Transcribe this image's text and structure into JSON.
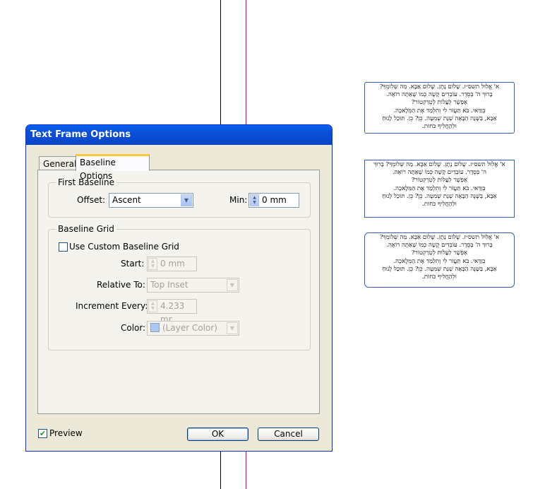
{
  "dialog": {
    "title": "Text Frame Options",
    "tabs": [
      {
        "label": "General"
      },
      {
        "label": "Baseline Options"
      }
    ],
    "first_baseline": {
      "legend": "First Baseline",
      "offset_label": "Offset:",
      "offset_value": "Ascent",
      "min_label": "Min:",
      "min_value": "0 mm"
    },
    "baseline_grid": {
      "legend": "Baseline Grid",
      "use_custom_label": "Use Custom Baseline Grid",
      "use_custom_checked": false,
      "start_label": "Start:",
      "start_value": "0 mm",
      "relative_to_label": "Relative To:",
      "relative_to_value": "Top Inset",
      "increment_label": "Increment Every:",
      "increment_value": "4.233 mr",
      "color_label": "Color:",
      "color_value": "(Layer Color)",
      "color_swatch": "#a9c9f3"
    },
    "preview_label": "Preview",
    "preview_checked": true,
    "ok_label": "OK",
    "cancel_label": "Cancel"
  },
  "colors": {
    "title_bar": "#0a52df",
    "frame_border": "#2f5fc6",
    "guide_magenta": "#b000b0"
  },
  "icons": {
    "dropdown": "chevron-down-icon",
    "spinner": "spin-arrows-icon",
    "check": "check-icon"
  },
  "frames": [
    {
      "lines": [
        "א' אֱלוּל תשס״ז. שָׁלוֹם נָתָן. שָׁלוֹם אַבָּא. מַה שְּׁלוֹמְךָ?",
        "בָּרוּךְ ה' בְּסֵדֶר. עוֹבְדִים קָשֶׁה כְּמוֹ שֶׁאַתָּה רוֹאֶה.",
        "אֶפְשָׁר לַעֲלוֹת לְטְרַקְטוֹר?",
        "בְּוַדַּאי. בֹּא תַּעֲזֹר לִי וְתִלְמַד אֶת הַמְּלָאכָה.",
        "אַבָּא, בַּשָּׁנָה הַבָּאָה שְׁנַת שְׁמִטָּה. כֵּן? כֵּן. תּוּכַל לָנוּחַ",
        "וּלְהַחֲלִיף כֹּחוֹת."
      ]
    },
    {
      "lines": [
        "א' אֱלוּל תשס״ז. שָׁלוֹם נָתָן. שָׁלוֹם אַבָּא. מַה שְּׁלוֹמְךָ? בָּרוּךְ",
        "ה' בְּסֵדֶר. עוֹבְדִים קָשֶׁה כְּמוֹ שֶׁאַתָּה רוֹאֶה.",
        "אֶפְשָׁר לַעֲלוֹת לְטְרַקְטוֹר?",
        "בְּוַדַּאי. בֹּא תַּעֲזֹר לִי וְתִלְמַד אֶת הַמְּלָאכָה.",
        "אַבָּא, בַּשָּׁנָה הַבָּאָה שְׁנַת שְׁמִטָּה. כֵּן? כֵּן. תּוּכַל לָנוּחַ",
        "וּלְהַחֲלִיף כֹּחוֹת."
      ]
    },
    {
      "lines": [
        "א' אֱלוּל תשס״ז. שָׁלוֹם נָתָן. שָׁלוֹם אַבָּא. מַה שְּׁלוֹמְךָ?",
        "בָּרוּךְ ה' בְּסֵדֶר. עוֹבְדִים קָשֶׁה כְּמוֹ שֶׁאַתָּה רוֹאֶה.",
        "אֶפְשָׁר לַעֲלוֹת לְטְרַקְטוֹר?",
        "בְּוַדַּאי. בֹּא תַּעֲזֹר לִי וְתִלְמַד אֶת הַמְּלָאכָה.",
        "אַבָּא, בַּשָּׁנָה הַבָּאָה שְׁנַת שְׁמִטָּה. כֵּן? כֵּן. תּוּכַל לָנוּחַ",
        "וּלְהַחֲלִיף כֹּחוֹת."
      ]
    }
  ]
}
